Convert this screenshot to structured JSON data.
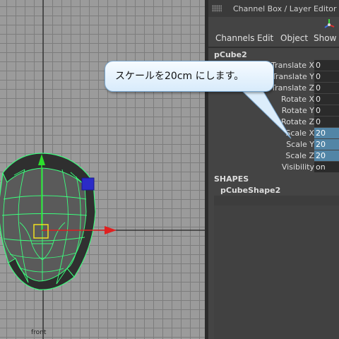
{
  "viewport": {
    "camera_label": "front",
    "grid_color": "#7d7d7d",
    "wireframe_color": "#3cff7d"
  },
  "channel_box": {
    "title": "Channel Box / Layer Editor",
    "menu": [
      "Channels",
      "Edit",
      "Object",
      "Show"
    ],
    "object_name": "pCube2",
    "attributes": [
      {
        "label": "Translate X",
        "value": "0",
        "selected": false
      },
      {
        "label": "Translate Y",
        "value": "0",
        "selected": false
      },
      {
        "label": "Translate Z",
        "value": "0",
        "selected": false
      },
      {
        "label": "Rotate X",
        "value": "0",
        "selected": false
      },
      {
        "label": "Rotate Y",
        "value": "0",
        "selected": false
      },
      {
        "label": "Rotate Z",
        "value": "0",
        "selected": false
      },
      {
        "label": "Scale X",
        "value": "20",
        "selected": true
      },
      {
        "label": "Scale Y",
        "value": "20",
        "selected": true
      },
      {
        "label": "Scale Z",
        "value": "20",
        "selected": true
      },
      {
        "label": "Visibility",
        "value": "on",
        "selected": false
      }
    ],
    "shapes_header": "SHAPES",
    "shape_name": "pCubeShape2",
    "selection_color": "#5285a6"
  },
  "callout": {
    "text": "スケールを20cm にします。"
  }
}
